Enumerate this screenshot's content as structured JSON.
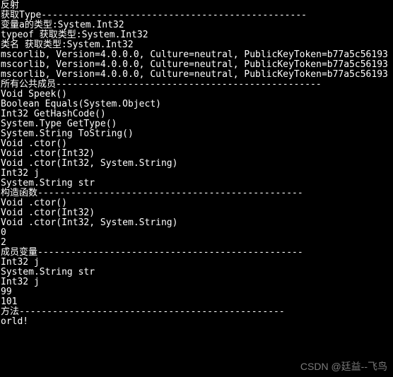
{
  "lines": [
    "反射",
    "获取Type------------------------------------------------",
    "变量a的类型:System.Int32",
    "typeof 获取类型:System.Int32",
    "类名 获取类型:System.Int32",
    "mscorlib, Version=4.0.0.0, Culture=neutral, PublicKeyToken=b77a5c56193",
    "mscorlib, Version=4.0.0.0, Culture=neutral, PublicKeyToken=b77a5c56193",
    "mscorlib, Version=4.0.0.0, Culture=neutral, PublicKeyToken=b77a5c56193",
    "所有公共成员------------------------------------------------",
    "Void Speek()",
    "Boolean Equals(System.Object)",
    "Int32 GetHashCode()",
    "System.Type GetType()",
    "System.String ToString()",
    "Void .ctor()",
    "Void .ctor(Int32)",
    "Void .ctor(Int32, System.String)",
    "Int32 j",
    "System.String str",
    "构造函数------------------------------------------------",
    "Void .ctor()",
    "Void .ctor(Int32)",
    "Void .ctor(Int32, System.String)",
    "0",
    "2",
    "成员变量------------------------------------------------",
    "Int32 j",
    "System.String str",
    "Int32 j",
    "99",
    "101",
    "方法------------------------------------------------",
    "orld!"
  ],
  "watermark": "CSDN @廷益--飞鸟"
}
